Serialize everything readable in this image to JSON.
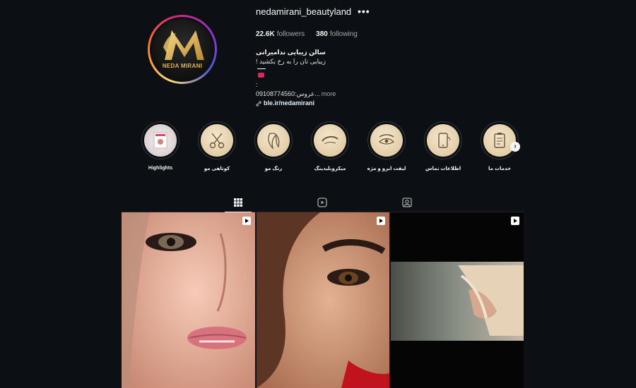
{
  "profile": {
    "username": "nedamirani_beautyland",
    "more_label": "•••",
    "logo_text": "NEDA MIRANI",
    "stats": {
      "followers_count": "22.6K",
      "followers_label": "followers",
      "following_count": "380",
      "following_label": "following"
    },
    "bio": {
      "name": "سالن زیبایی ندامیرانی",
      "tagline": "زیبایی تان را به رخ بکشید !",
      "colon": ":",
      "phone_line": "عروس:09108774560...",
      "more_label": "more",
      "link": "ble.ir/nedamirani"
    }
  },
  "highlights": [
    {
      "label": "Highlights",
      "icon": "bride-photo"
    },
    {
      "label": "کوتاهی مو",
      "icon": "scissors-icon"
    },
    {
      "label": "رنگ مو",
      "icon": "hair-icon"
    },
    {
      "label": "میکروبلیدینگ",
      "icon": "eyebrow-icon"
    },
    {
      "label": "لیفت ابرو و مژه",
      "icon": "eye-lash-icon"
    },
    {
      "label": "اطلاعات تماس",
      "icon": "phone-icon"
    },
    {
      "label": "خدمات ما",
      "icon": "clipboard-icon"
    }
  ],
  "tabs": [
    "posts",
    "reels",
    "tagged"
  ],
  "colors": {
    "background": "#0c1014",
    "gold": "#d9b45a",
    "link": "#e0f1ff"
  },
  "posts": [
    {
      "type": "reel",
      "icon": "reel-icon"
    },
    {
      "type": "reel",
      "icon": "reel-icon"
    },
    {
      "type": "reel",
      "icon": "reel-icon"
    }
  ]
}
